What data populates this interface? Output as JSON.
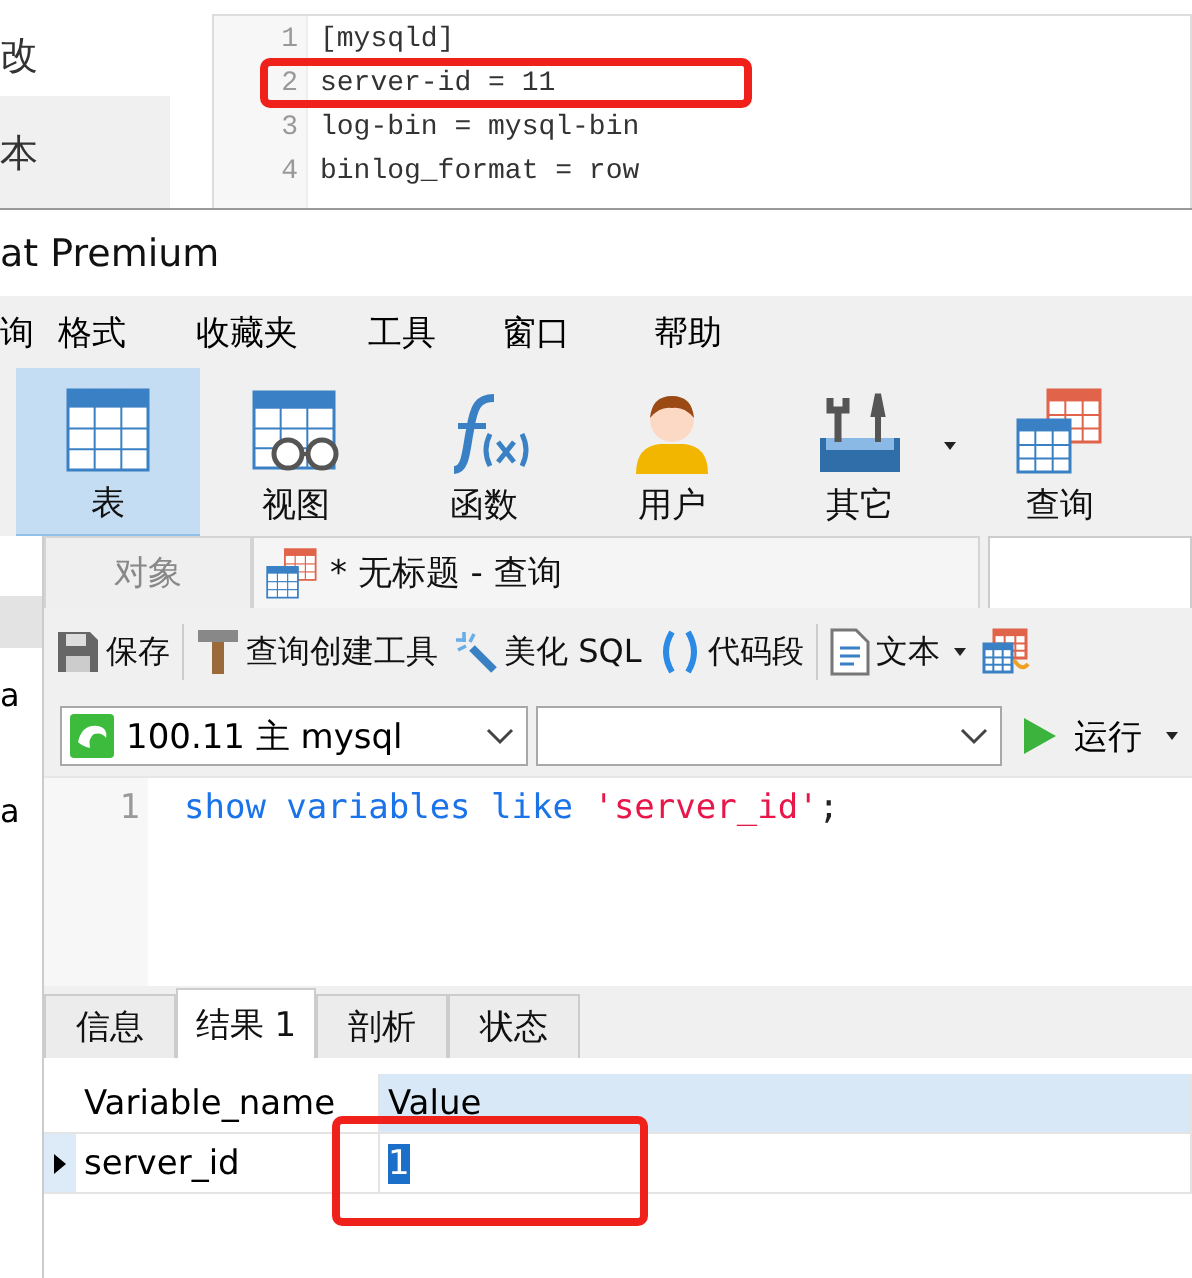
{
  "background_doc": {
    "side_items": [
      {
        "text": "改"
      },
      {
        "text": "本"
      }
    ],
    "code_lines": [
      {
        "number": "1",
        "text": "[mysqld]"
      },
      {
        "number": "2",
        "text": "server-id = 11"
      },
      {
        "number": "3",
        "text": "log-bin = mysql-bin"
      },
      {
        "number": "4",
        "text": "binlog_format = row"
      }
    ]
  },
  "window": {
    "title": "at Premium"
  },
  "menu": [
    "询",
    "格式",
    "收藏夹",
    "工具",
    "窗口",
    "帮助"
  ],
  "toolbar": [
    {
      "kind": "table",
      "label": "表",
      "selected": true,
      "dropdown": false
    },
    {
      "kind": "view",
      "label": "视图",
      "selected": false,
      "dropdown": false
    },
    {
      "kind": "function",
      "label": "函数",
      "selected": false,
      "dropdown": false
    },
    {
      "kind": "user",
      "label": "用户",
      "selected": false,
      "dropdown": false
    },
    {
      "kind": "other",
      "label": "其它",
      "selected": false,
      "dropdown": true
    },
    {
      "kind": "query",
      "label": "查询",
      "selected": false,
      "dropdown": false
    }
  ],
  "side_panel": {
    "items": [
      "a",
      "a"
    ]
  },
  "tabs": [
    {
      "label": "对象",
      "selected": false
    },
    {
      "label": "* 无标题 - 查询",
      "selected": true
    }
  ],
  "query_toolbar": [
    {
      "kind": "save",
      "label": "保存"
    },
    {
      "kind": "builder",
      "label": "查询创建工具"
    },
    {
      "kind": "beautify",
      "label": "美化 SQL"
    },
    {
      "kind": "snippet",
      "label": "代码段"
    },
    {
      "kind": "text",
      "label": "文本",
      "dropdown": true
    },
    {
      "kind": "export"
    }
  ],
  "connection": {
    "value": "100.11 主 mysql"
  },
  "run_button": {
    "label": "运行"
  },
  "editor": {
    "lines": [
      {
        "number": "1",
        "tokens": [
          {
            "kind": "keyword",
            "text": "show variables like "
          },
          {
            "kind": "string",
            "text": "'server_id'"
          },
          {
            "kind": "plain",
            "text": ";"
          }
        ]
      }
    ]
  },
  "result_tabs": [
    {
      "label": "信息",
      "selected": false
    },
    {
      "label": "结果 1",
      "selected": true
    },
    {
      "label": "剖析",
      "selected": false
    },
    {
      "label": "状态",
      "selected": false
    }
  ],
  "grid": {
    "columns": [
      {
        "label": "Variable_name",
        "selected": false
      },
      {
        "label": "Value",
        "selected": true
      }
    ],
    "rows": [
      {
        "current": true,
        "cells": [
          {
            "text": "server_id",
            "selected": false
          },
          {
            "text": "1",
            "selected": true
          }
        ]
      }
    ]
  }
}
